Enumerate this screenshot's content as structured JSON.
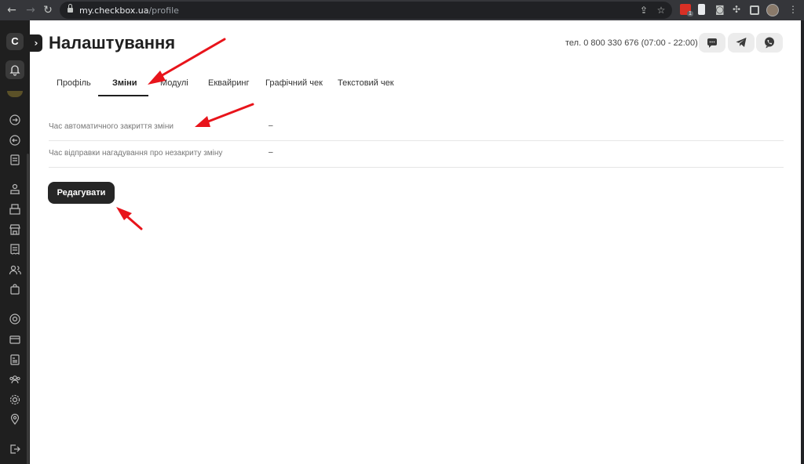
{
  "browser": {
    "url_host": "my.checkbox.ua",
    "url_path": "/profile",
    "ext_badge": "1"
  },
  "sidebar": {
    "logo": "C",
    "icons": [
      "bell-icon",
      "login-icon",
      "logout-icon",
      "report-icon",
      "cashier-icon",
      "cash-register-icon",
      "store-icon",
      "receipt-list-icon",
      "users-icon",
      "bag-icon",
      "coins-icon",
      "card-icon",
      "document-icon",
      "team-icon",
      "settings-icon",
      "location-icon",
      "exit-icon"
    ]
  },
  "header": {
    "title": "Налаштування",
    "phone": "тел. 0 800 330 676 (07:00 - 22:00)",
    "contact_icons": [
      "chat-icon",
      "telegram-icon",
      "viber-icon"
    ]
  },
  "tabs": [
    {
      "label": "Профіль",
      "active": false
    },
    {
      "label": "Зміни",
      "active": true
    },
    {
      "label": "Модулі",
      "active": false
    },
    {
      "label": "Еквайринг",
      "active": false
    },
    {
      "label": "Графічний чек",
      "active": false
    },
    {
      "label": "Текстовий чек",
      "active": false
    }
  ],
  "settings": [
    {
      "label": "Час автоматичного закриття зміни",
      "value": "–"
    },
    {
      "label": "Час відправки нагадування про незакриту зміну",
      "value": "–"
    }
  ],
  "edit_button": "Редагувати",
  "colors": {
    "annotation_arrow": "#e8141b",
    "sidebar_bg": "#1f1f1f",
    "button_bg": "#262626"
  }
}
